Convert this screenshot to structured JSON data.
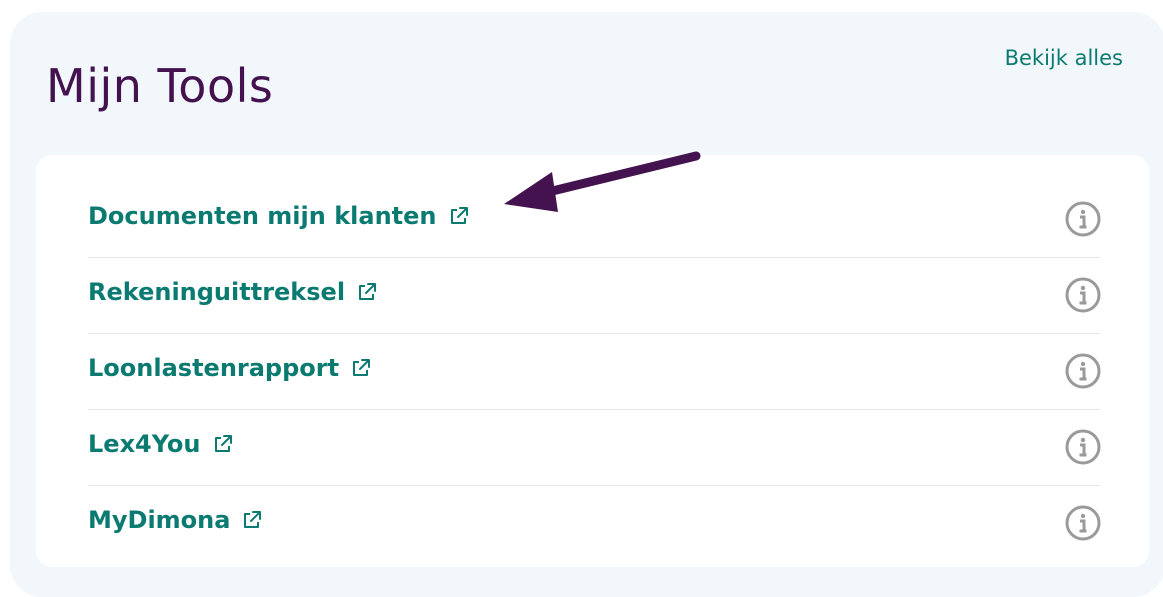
{
  "header": {
    "title": "Mijn Tools",
    "view_all_label": "Bekijk alles"
  },
  "tools": [
    {
      "label": "Documenten mijn klanten",
      "icon": "external-link-icon",
      "info_icon": "info-icon"
    },
    {
      "label": "Rekeninguittreksel",
      "icon": "external-link-icon",
      "info_icon": "info-icon"
    },
    {
      "label": "Loonlastenrapport",
      "icon": "external-link-icon",
      "info_icon": "info-icon"
    },
    {
      "label": "Lex4You",
      "icon": "external-link-icon",
      "info_icon": "info-icon"
    },
    {
      "label": "MyDimona",
      "icon": "external-link-icon",
      "info_icon": "info-icon"
    }
  ],
  "annotation": {
    "arrow_icon": "arrow-annotation",
    "color": "#44134f"
  },
  "colors": {
    "title": "#44134f",
    "link": "#0b7b72",
    "panel_background": "#f1f7fa",
    "card_background": "#ffffff",
    "info_icon": "#9a9a9a"
  }
}
